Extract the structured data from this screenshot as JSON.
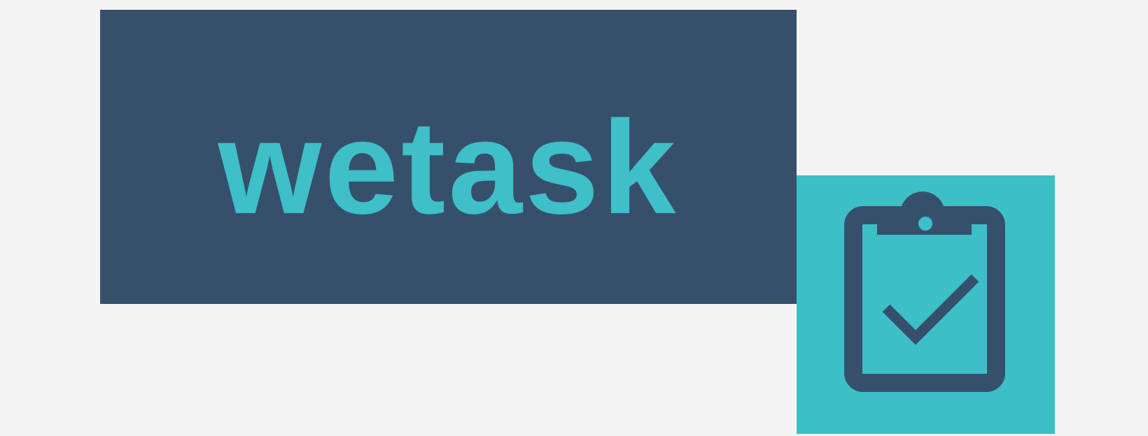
{
  "logo": {
    "wordmark": "wetask",
    "icon": "clipboard-check-icon"
  },
  "colors": {
    "background": "#f4f4f4",
    "banner": "#36506c",
    "accent": "#3fbfc8"
  }
}
